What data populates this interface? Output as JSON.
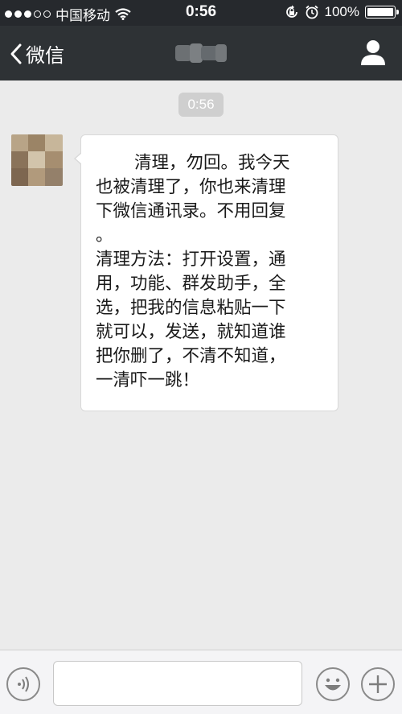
{
  "status_bar": {
    "carrier": "中国移动",
    "time": "0:56",
    "battery_percent": "100%",
    "battery_level": 1.0,
    "icons": [
      "signal-dots-icon",
      "wifi-icon",
      "rotation-lock-icon",
      "alarm-icon",
      "battery-icon"
    ]
  },
  "nav": {
    "back_label": "微信",
    "title": "",
    "right_icon": "person-icon"
  },
  "chat": {
    "timestamp": "0:56",
    "message_lines": [
      "清理，勿回。我今天",
      "也被清理了，你也来清理",
      "下微信通讯录。不用回复",
      "。",
      "清理方法：打开设置，通",
      "用，功能、群发助手，全",
      "选，把我的信息粘贴一下",
      "就可以，发送，就知道谁",
      "把你删了，不清不知道，",
      "一清吓一跳！"
    ]
  },
  "input_bar": {
    "text_value": "",
    "icons": [
      "voice-icon",
      "emoji-icon",
      "plus-icon"
    ]
  },
  "colors": {
    "status_bar_bg": "#26292d",
    "nav_bg": "#2e3235",
    "chat_bg": "#ebebeb",
    "bubble_bg": "#ffffff",
    "timestamp_bg": "#cfcfcf",
    "input_bar_bg": "#f4f4f6"
  }
}
